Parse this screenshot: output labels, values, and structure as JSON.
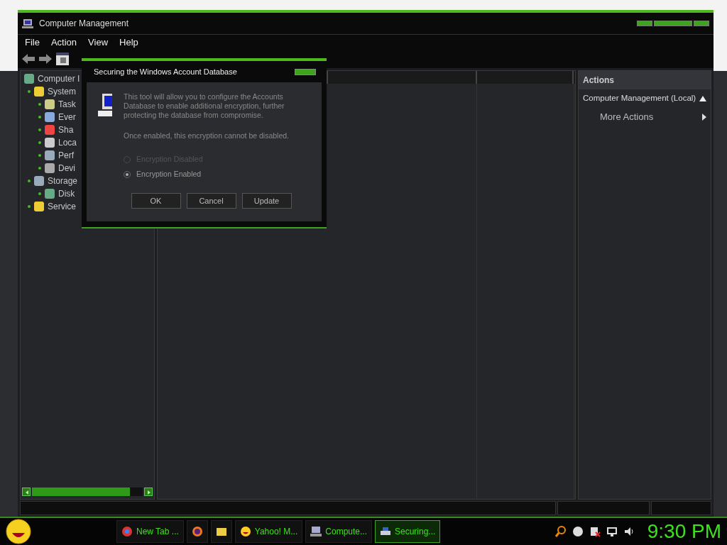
{
  "window": {
    "title": "Computer Management"
  },
  "menu": [
    "File",
    "Action",
    "View",
    "Help"
  ],
  "tree": [
    {
      "label": "Computer I",
      "children": [
        {
          "label": "System",
          "children": [
            {
              "label": "Task"
            },
            {
              "label": "Ever"
            },
            {
              "label": "Sha"
            },
            {
              "label": "Loca"
            },
            {
              "label": "Perf"
            },
            {
              "label": "Devi"
            }
          ]
        },
        {
          "label": "Storage",
          "children": [
            {
              "label": "Disk"
            }
          ]
        },
        {
          "label": "Service"
        }
      ]
    }
  ],
  "actions": {
    "title": "Actions",
    "items": [
      {
        "label": "Computer Management (Local)",
        "kind": "header"
      },
      {
        "label": "More Actions",
        "kind": "link"
      }
    ]
  },
  "dialog": {
    "title": "Securing the Windows Account Database",
    "message": "This tool will allow you to configure the Accounts Database to enable additional encryption, further protecting the database from compromise.",
    "note": "Once enabled, this encryption cannot be disabled.",
    "options": [
      {
        "label": "Encryption Disabled",
        "selected": false,
        "disabled": true
      },
      {
        "label": "Encryption Enabled",
        "selected": true,
        "disabled": false
      }
    ],
    "buttons": [
      "OK",
      "Cancel",
      "Update"
    ]
  },
  "taskbar": {
    "items": [
      {
        "label": "New Tab ...",
        "kind": "chrome",
        "selected": false
      },
      {
        "kind": "firefox",
        "selected": false
      },
      {
        "kind": "folder",
        "selected": false
      },
      {
        "label": "Yahoo! M...",
        "kind": "smiley",
        "selected": false
      },
      {
        "label": "Compute...",
        "kind": "computer",
        "selected": false
      },
      {
        "label": "Securing...",
        "kind": "printer",
        "selected": true
      }
    ],
    "clock": "9:30 PM"
  }
}
